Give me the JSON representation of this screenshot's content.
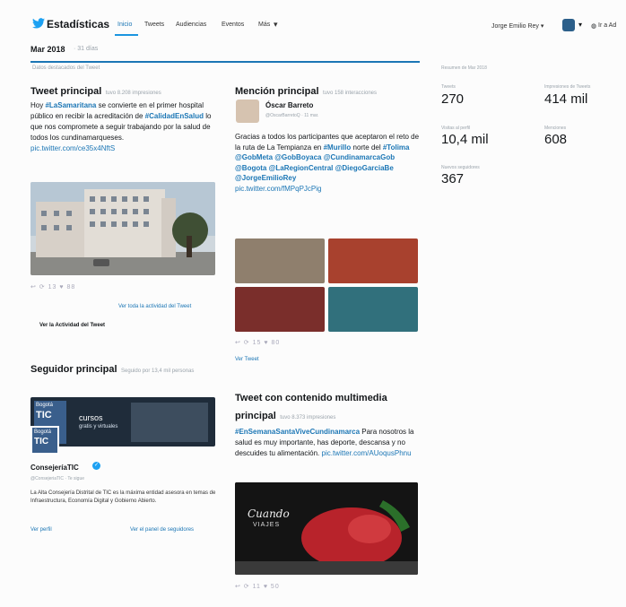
{
  "nav": {
    "brand": "Estadísticas",
    "tabs": [
      {
        "label": "Inicio"
      },
      {
        "label": "Tweets"
      },
      {
        "label": "Audiencias"
      },
      {
        "label": "Eventos"
      },
      {
        "label": "Más"
      }
    ],
    "caret": "▾",
    "account": "Jorge Emilio Rey ▾",
    "globe": "◍",
    "lang": "Ir a Ad"
  },
  "period": {
    "title": "Mar 2018",
    "days": "· 31 días"
  },
  "highlights_label": "Datos destacados del Tweet",
  "top_tweet": {
    "title": "Tweet principal",
    "sub": "tuvo 8.208 impresiones",
    "text_1": "Hoy ",
    "tag_1": "#LaSamaritana",
    "text_2": " se convierte en el primer hospital público en recibir la acreditación de ",
    "tag_2": "#CalidadEnSalud",
    "text_3": " lo que nos compromete a seguir trabajando por la salud de todos los cundinamarqueses.",
    "link": "pic.twitter.com/ce35x4NftS",
    "actions": "↩  ⟳ 13  ♥ 88",
    "view_activity_link": "Ver toda la actividad del Tweet",
    "tweet_activity": "Ver la Actividad del Tweet"
  },
  "top_mention": {
    "title": "Mención principal",
    "sub": "tuvo 158 interacciones",
    "user_name": "Óscar Barreto",
    "user_handle": "@OscarBarretoQ · 11 mar.",
    "text_1": "Gracias a todos los participantes que aceptaron el reto de la ruta de La Tempianza en ",
    "tag_1": "#Murillo",
    "text_2": " norte del ",
    "tag_2": "#Tolima",
    "tags_rest": "@GobMeta @GobBoyaca @CundinamarcaGob @Bogota @LaRegionCentral @DiegoGarciaBe @JorgeEmilioRey",
    "link": "pic.twitter.com/fMPqPJcPig",
    "actions": "↩  ⟳ 15  ♥ 80",
    "view_tweet": "Ver Tweet"
  },
  "top_follower": {
    "title": "Seguidor principal",
    "sub": "Seguido por 13,4 mil personas",
    "banner_text_1": "Bogotá",
    "banner_text_2": "TIC",
    "banner_text_3": "cursos",
    "banner_text_4": "gratis y virtuales",
    "name": "ConsejeríaTIC",
    "handle": "@ConsejeriaTIC · Te sigue",
    "bio": "La Alta Consejería Distrital de TIC es la máxima entidad asesora en temas de Infraestructura, Economía Digital y Gobierno Abierto.",
    "view_profile": "Ver perfil",
    "view_followers": "Ver el panel de seguidores"
  },
  "top_media": {
    "title_1": "Tweet con contenido multimedia",
    "title_2": "principal",
    "sub": "tuvo 8.373 impresiones",
    "tag_1": "#EnSemanaSantaViveCundinamarca",
    "text_1": " Para nosotros la salud es muy importante, has deporte, descansa y no descuides tu alimentación. ",
    "link": "pic.twitter.com/AUoqusPhnu",
    "actions": "↩  ⟳ 11  ♥ 50",
    "image_title": "Cuando",
    "image_subtitle": "VIAJES"
  },
  "summary": {
    "label": "Resumen de Mar 2018",
    "stats": [
      {
        "label": "Tweets",
        "value": "270"
      },
      {
        "label": "Impresiones de Tweets",
        "value": "414 mil"
      },
      {
        "label": "Visitas al perfil",
        "value": "10,4 mil"
      },
      {
        "label": "Menciones",
        "value": "608"
      },
      {
        "label": "Nuevos seguidores",
        "value": "367"
      }
    ]
  }
}
